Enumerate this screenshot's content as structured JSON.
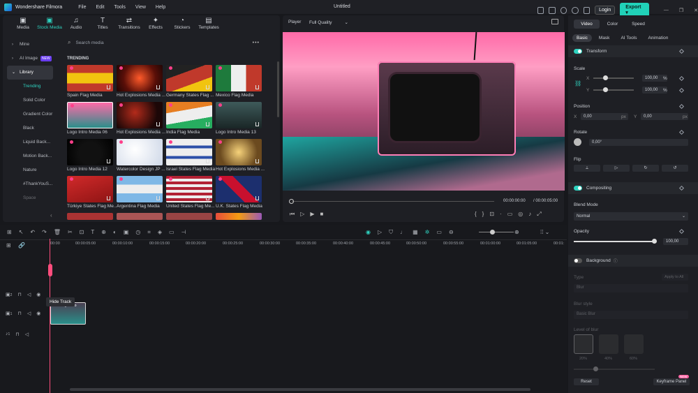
{
  "app": {
    "name": "Wondershare Filmora",
    "document_title": "Untitled",
    "menu": [
      "File",
      "Edit",
      "Tools",
      "View",
      "Help"
    ],
    "login": "Login",
    "export": "Export"
  },
  "media_tabs": [
    {
      "label": "Media",
      "icon": "media-icon"
    },
    {
      "label": "Stock Media",
      "icon": "stock-media-icon",
      "active": true
    },
    {
      "label": "Audio",
      "icon": "music-note-icon"
    },
    {
      "label": "Titles",
      "icon": "text-icon"
    },
    {
      "label": "Transitions",
      "icon": "transitions-icon"
    },
    {
      "label": "Effects",
      "icon": "effects-icon"
    },
    {
      "label": "Stickers",
      "icon": "sticker-icon"
    },
    {
      "label": "Templates",
      "icon": "templates-icon"
    }
  ],
  "sidebar": {
    "mine": "Mine",
    "ai_image": "AI Image",
    "ai_badge": "NEW",
    "library": "Library",
    "items": [
      "Trending",
      "Solid Color",
      "Gradient Color",
      "Black",
      "Liquid Back...",
      "Motion Back...",
      "Nature",
      "#ThankYouS...",
      "Space"
    ]
  },
  "search": {
    "placeholder": "Search media"
  },
  "section_label": "TRENDING",
  "media_items": [
    "Spain Flag Media",
    "Hot Explosions Media ...",
    "Germany States Flag ...",
    "Mexico Flag Media",
    "Logo Intro Media 06",
    "Hot Explosions Media ...",
    "India Flag Media",
    "Logo Intro Media 13",
    "Logo Intro Media 12",
    "Watercolor Design JP ...",
    "Israel States Flag Media",
    "Hot Explosions Media ...",
    "Türkiye States Flag Me...",
    "Argentina Flag Media",
    "United States Flag Me...",
    "U.K. States Flag Media"
  ],
  "player": {
    "label": "Player",
    "quality": "Full Quality",
    "current_time": "00:00:00:00",
    "total_time": "/ 00:00:05:00"
  },
  "props": {
    "tabs": [
      "Video",
      "Color",
      "Speed"
    ],
    "subtabs": [
      "Basic",
      "Mask",
      "AI Tools",
      "Animation"
    ],
    "transform": "Transform",
    "scale": "Scale",
    "scale_x_label": "X",
    "scale_x": "100,00",
    "scale_y_label": "Y",
    "scale_y": "100,00",
    "percent": "%",
    "position": "Position",
    "pos_x_label": "X",
    "pos_x": "0,00",
    "pos_y_label": "Y",
    "pos_y": "0,00",
    "px": "px",
    "rotate": "Rotate",
    "rotate_value": "0,00°",
    "flip": "Flip",
    "compositing": "Compositing",
    "blend_mode": "Blend Mode",
    "blend_value": "Normal",
    "opacity": "Opacity",
    "opacity_value": "100,00",
    "opacity_fraction": 1.0,
    "background": "Background",
    "type": "Type",
    "apply_all": "Apply to All",
    "type_value": "Blur",
    "blur_style": "Blur style",
    "blur_style_value": "Basic Blur",
    "level_of_blur": "Level of blur",
    "blur_levels": [
      "20%",
      "40%",
      "60%"
    ],
    "reset": "Reset",
    "keyframe_panel": "Keyframe Panel",
    "keyframe_badge": "NEW"
  },
  "timeline": {
    "ruler": [
      "00:00",
      "00:00:05:00",
      "00:00:10:00",
      "00:00:15:00",
      "00:00:20:00",
      "00:00:25:00",
      "00:00:30:00",
      "00:00:35:00",
      "00:00:40:00",
      "00:00:45:00",
      "00:00:50:00",
      "00:00:55:00",
      "00:01:00:00",
      "00:01:05:00",
      "00:01:"
    ],
    "tracks": [
      "2",
      "1",
      "1"
    ],
    "tooltip": "Hide Track",
    "clip_label": "Logo Intro"
  }
}
